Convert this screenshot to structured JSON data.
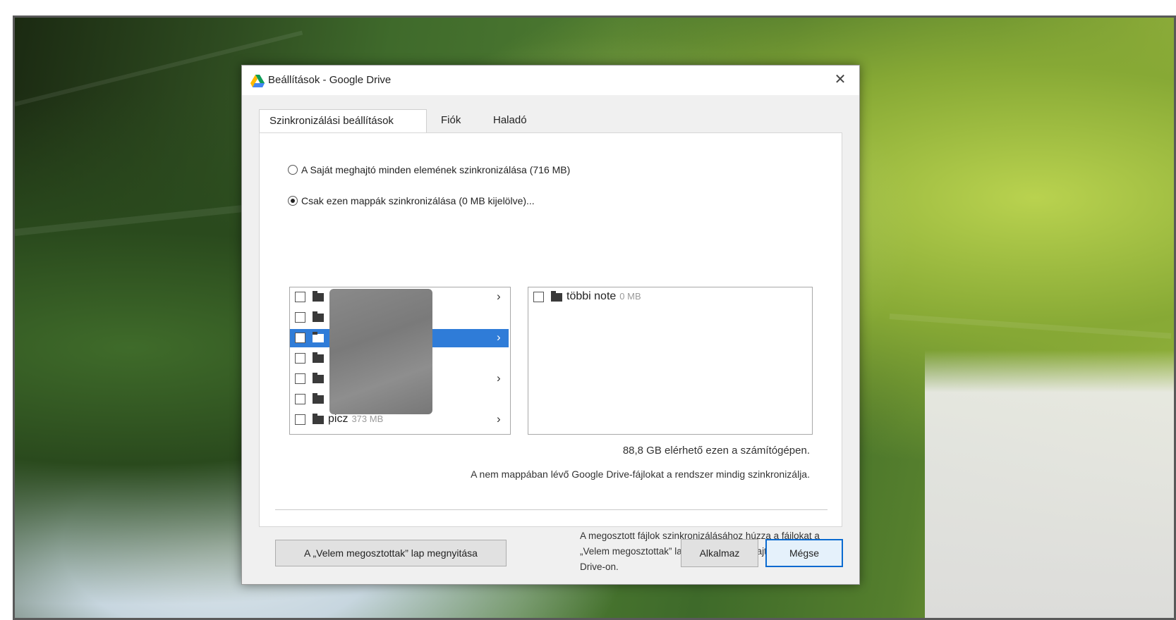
{
  "dialog": {
    "title": "Beállítások - Google Drive",
    "close_glyph": "✕",
    "tabs": [
      {
        "label": "Szinkronizálási beállítások",
        "active": true
      },
      {
        "label": "Fiók",
        "active": false
      },
      {
        "label": "Haladó",
        "active": false
      }
    ],
    "sync_options": {
      "all_label": "A Saját meghajtó minden elemének szinkronizálása (716 MB)",
      "folders_label": "Csak ezen mappák szinkronizálása (0 MB kijelölve)...",
      "selected": "folders"
    },
    "folders": [
      {
        "name": "",
        "size": "",
        "has_children": true,
        "selected": false
      },
      {
        "name": "",
        "size": "",
        "has_children": false,
        "selected": false
      },
      {
        "name": "",
        "size": "",
        "has_children": true,
        "selected": true
      },
      {
        "name": "",
        "size": "",
        "has_children": false,
        "selected": false
      },
      {
        "name": "",
        "size": "",
        "has_children": true,
        "selected": false
      },
      {
        "name": "",
        "size": "",
        "has_children": false,
        "selected": false
      },
      {
        "name": "picz",
        "size": "373 MB",
        "has_children": true,
        "selected": false
      }
    ],
    "subfolders": [
      {
        "name": "többi note",
        "size": "0 MB"
      }
    ],
    "available_space": "88,8 GB elérhető ezen a számítógépen.",
    "non_folder_note": "A nem mappában lévő Google Drive-fájlokat a rendszer mindig szinkronizálja.",
    "shared_button": "A „Velem megosztottak” lap megnyitása",
    "shared_help": "A megosztott fájlok szinkronizálásához húzza a fájlokat a „Velem megosztottak” lapról a Saját meghajtóba a Google Drive-on.",
    "apply_button": "Alkalmaz",
    "cancel_button": "Mégse"
  },
  "icons": {
    "drive_logo": "google-drive-logo",
    "folder": "folder-icon",
    "chevron": "›",
    "scroll_up": "▲",
    "scroll_down": "▼"
  }
}
